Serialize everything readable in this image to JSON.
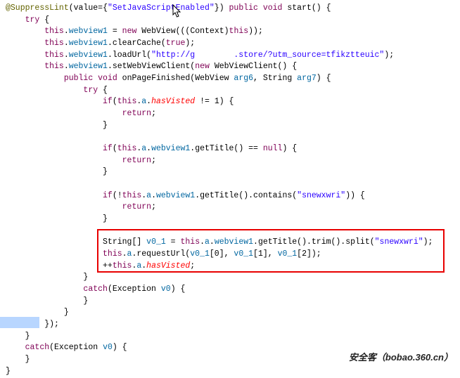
{
  "annotation": {
    "at": "@",
    "name": "SuppressLint",
    "valueKey": "value=",
    "valueStr": "\"SetJavaScriptEnabled\""
  },
  "kw": {
    "public": "public",
    "void": "void",
    "try": "try",
    "catch": "catch",
    "this": "this",
    "new": "new",
    "null": "null",
    "return": "return",
    "trueLit": "true",
    "if": "if",
    "Exception": "Exception"
  },
  "id": {
    "start": "start",
    "webview1": "webview1",
    "a": "a",
    "WebView": "WebView",
    "Context": "Context",
    "clearCache": "clearCache",
    "loadUrl": "loadUrl",
    "setWebViewClient": "setWebViewClient",
    "WebViewClient": "WebViewClient",
    "onPageFinished": "onPageFinished",
    "String": "String",
    "arg6": "arg6",
    "arg7": "arg7",
    "hasVisited": "hasVisted",
    "getTitle": "getTitle",
    "contains": "contains",
    "trim": "trim",
    "split": "split",
    "requestUrl": "requestUrl",
    "v0_1": "v0_1",
    "v0": "v0"
  },
  "str": {
    "url": "\"http://g        .store/?utm_source=tfikztteuic\"",
    "snewxwri": "\"snewxwri\""
  },
  "num": {
    "one": "1",
    "zero": "0",
    "two": "2"
  },
  "watermark": "安全客（bobao.360.cn）"
}
